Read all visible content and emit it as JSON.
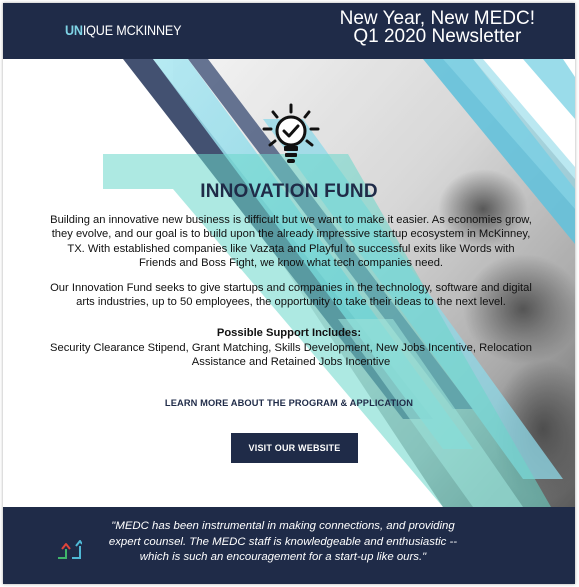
{
  "header": {
    "logo_prefix": "UN",
    "logo_rest": "IQUE MCKINNEY",
    "newsletter_title_line1": "New Year, New MEDC!",
    "newsletter_title_line2": "Q1 2020 Newsletter"
  },
  "colors": {
    "navy": "#1f2b48",
    "accent_cyan": "#7fd4e6",
    "accent_teal": "#55d2c3"
  },
  "hero": {
    "icon": "lightbulb-check-icon",
    "title": "INNOVATION FUND",
    "paragraph1": "Building an innovative new business is difficult but we want to make it easier. As economies grow, they evolve, and our goal is to build upon the already impressive startup ecosystem in McKinney, TX. With established companies like Vazata and Playful to successful exits like Words with Friends and Boss Fight, we know what tech companies need.",
    "paragraph2": "Our Innovation Fund seeks to give startups and companies in the technology, software and digital arts industries, up to 50 employees, the opportunity to take their ideas to the next level.",
    "support_heading": "Possible Support Includes:",
    "support_list": "Security Clearance Stipend, Grant Matching, Skills Development, New Jobs Incentive, Relocation Assistance and Retained Jobs Incentive",
    "learn_more_link": "LEARN MORE ABOUT THE PROGRAM & APPLICATION",
    "visit_button": "VISIT OUR WEBSITE"
  },
  "testimonial": {
    "icon": "growth-arrows-icon",
    "quote": "\"MEDC has been instrumental in making connections, and providing expert counsel. The MEDC staff is knowledgeable and enthusiastic -- which is such an encouragement for a start-up like ours.\""
  }
}
